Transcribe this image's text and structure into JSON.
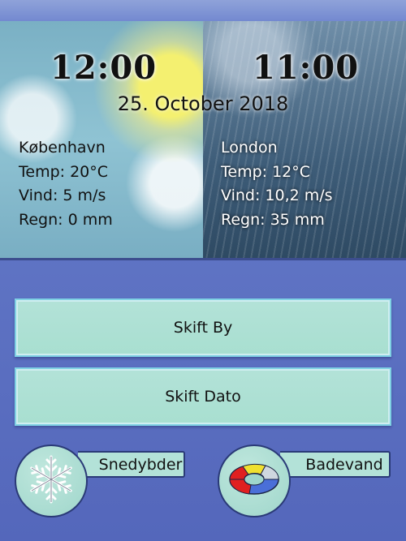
{
  "clocks": {
    "left": "12:00",
    "right": "11:00"
  },
  "date": "25. October 2018",
  "cities": [
    {
      "name": "København",
      "temp": "Temp: 20°C",
      "wind": "Vind: 5 m/s",
      "rain": "Regn: 0 mm",
      "weather": "sunny-cloudy"
    },
    {
      "name": "London",
      "temp": "Temp: 12°C",
      "wind": "Vind: 10,2 m/s",
      "rain": "Regn: 35 mm",
      "weather": "rainy"
    }
  ],
  "buttons": {
    "change_city": "Skift By",
    "change_date": "Skift Dato"
  },
  "features": {
    "snow_label": "Snedybder",
    "snow_icon": "snowflake-icon",
    "water_label": "Badevand",
    "water_icon": "lifebuoy-icon"
  },
  "colors": {
    "background": "#5f74c4",
    "button_fill": "#b3e2d8",
    "button_border": "#7fd1e4",
    "outline": "#2a3a77"
  }
}
